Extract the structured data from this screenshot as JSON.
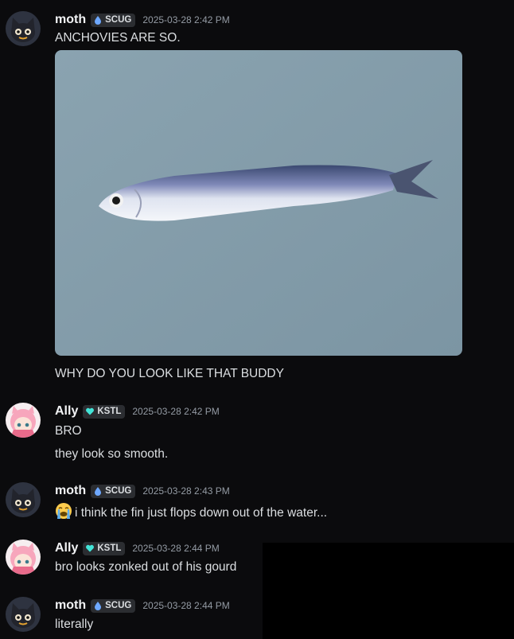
{
  "messages": [
    {
      "author": "moth",
      "tag": "SCUG",
      "timestamp": "2025-03-28 2:42 PM",
      "lines": [
        "ANCHOVIES ARE SO.",
        "WHY DO YOU LOOK LIKE THAT BUDDY"
      ]
    },
    {
      "author": "Ally",
      "tag": "KSTL",
      "timestamp": "2025-03-28 2:42 PM",
      "lines": [
        "BRO",
        "they look so smooth."
      ]
    },
    {
      "author": "moth",
      "tag": "SCUG",
      "timestamp": "2025-03-28 2:43 PM",
      "lines": [
        "i think the fin just flops down out of the water..."
      ]
    },
    {
      "author": "Ally",
      "tag": "KSTL",
      "timestamp": "2025-03-28 2:44 PM",
      "lines": [
        "bro looks zonked out of his gourd"
      ]
    },
    {
      "author": "moth",
      "tag": "SCUG",
      "timestamp": "2025-03-28 2:44 PM",
      "lines": [
        "literally"
      ]
    }
  ],
  "colors": {
    "scug_icon": "#6ea8ff",
    "kstl_icon": "#43e5d8",
    "background": "#0b0b0d"
  },
  "icons": {
    "scug": "droplet-icon",
    "kstl": "heart-icon",
    "crying_emoji": "loudly-crying-face-icon"
  }
}
